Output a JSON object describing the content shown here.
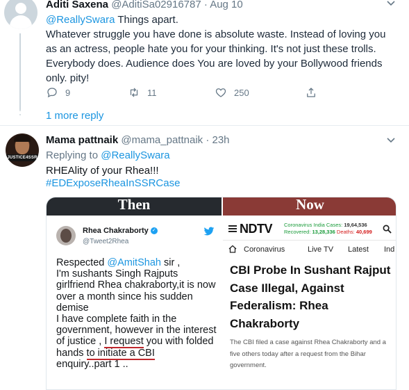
{
  "tweet1": {
    "author_name": "Aditi Saxena",
    "handle_date": "@AditiSa02916787 · Aug 10",
    "reply_mention": "@ReallySwara",
    "text_after_mention": " Things apart.",
    "body": "Whatever struggle you have done is absolute waste. Instead of loving you as an actress, people hate you for your thinking. It's not just these trolls. Everybody does. Audience does  You are loved by your Bollywood friends only. pity!",
    "replies_count": "9",
    "retweets_count": "11",
    "likes_count": "250",
    "more_reply": "1 more reply"
  },
  "tweet2": {
    "author_name": "Mama pattnaik",
    "handle_time": "@mama_pattnaik · 23h",
    "replying_to_label": "Replying to ",
    "replying_to_handle": "@ReallySwara",
    "text": "RHEAlity of your Rhea!!!",
    "hashtag": "#EDExposeRheaInSSRCase",
    "avatar_tag": "JUSTICE4SSR"
  },
  "media": {
    "left_banner": "Then",
    "right_banner": "Now",
    "embedded_tweet": {
      "name": "Rhea Chakraborty",
      "handle": "@Tweet2Rhea",
      "body_start": "Respected ",
      "mention": "@AmitShah",
      "body_part1": " sir ,\nI'm sushants Singh Rajputs girlfriend Rhea chakraborty,it is now over a month since his sudden demise\nI have complete faith in the government, however in the interest of justice , ",
      "underlined1": "I request",
      "body_part2": " you with folded hands ",
      "underlined2": "to initiate a CBI",
      "body_part3": "\nenquiry..part 1 .."
    },
    "ndtv": {
      "logo": "NDTV",
      "covid_india_label": "Coronavirus India Cases:",
      "covid_india_value": "19,64,536",
      "recovered_label": "Recovered:",
      "recovered_value": "13,28,336",
      "deaths_label": "Deaths:",
      "deaths_value": "40,699",
      "nav": [
        "Coronavirus",
        "Live TV",
        "Latest",
        "Ind"
      ],
      "headline": "CBI Probe In Sushant Rajput Case Illegal, Against Federalism: Rhea Chakraborty",
      "summary": "The CBI filed a case against Rhea Chakraborty and a five others today after a request from the Bihar government."
    }
  },
  "colors": {
    "link": "#1b95e0",
    "muted": "#657786",
    "then_banner": "#262a2f",
    "now_banner": "#8a3a36",
    "ndtv_red": "#d41c1c",
    "ndtv_green": "#1a9b3a"
  }
}
